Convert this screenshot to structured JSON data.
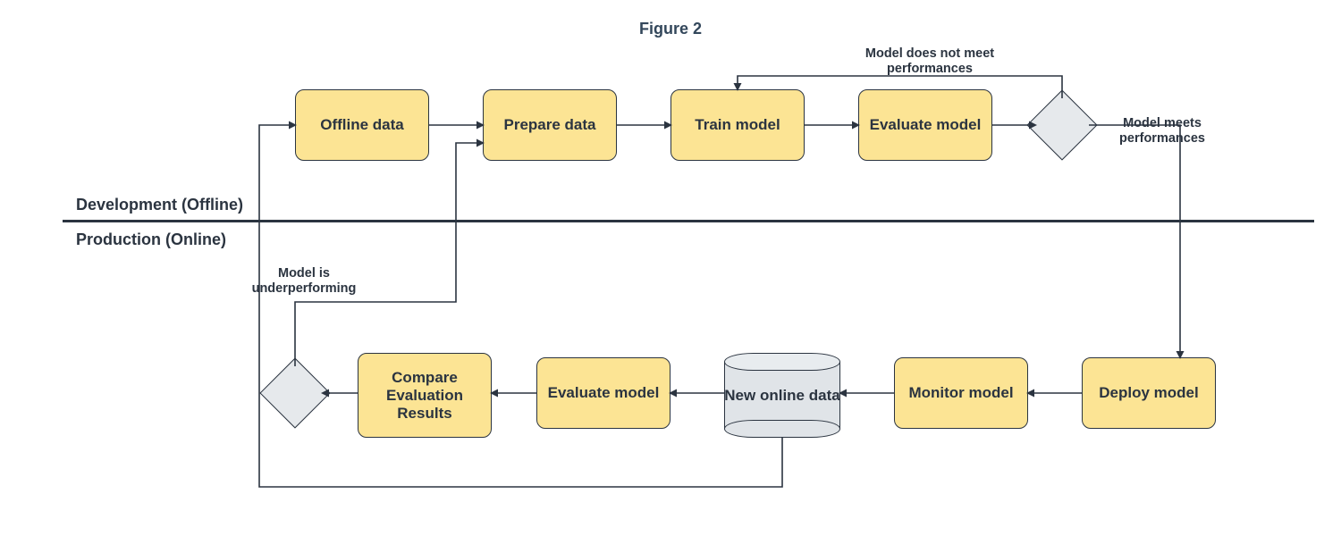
{
  "title": "Figure 2",
  "sections": {
    "dev_label": "Development (Offline)",
    "prod_label": "Production (Online)"
  },
  "nodes": {
    "offline_data": "Offline data",
    "prepare_data": "Prepare data",
    "train_model": "Train model",
    "evaluate_model_dev": "Evaluate model",
    "evaluate_model_prod": "Evaluate model",
    "monitor_model": "Monitor model",
    "deploy_model": "Deploy model",
    "compare_results": "Compare Evaluation Results",
    "new_online_data": "New online data"
  },
  "edge_labels": {
    "not_meet": "Model does not meet performances",
    "meets": "Model meets performances",
    "underperforming": "Model is underperforming"
  }
}
